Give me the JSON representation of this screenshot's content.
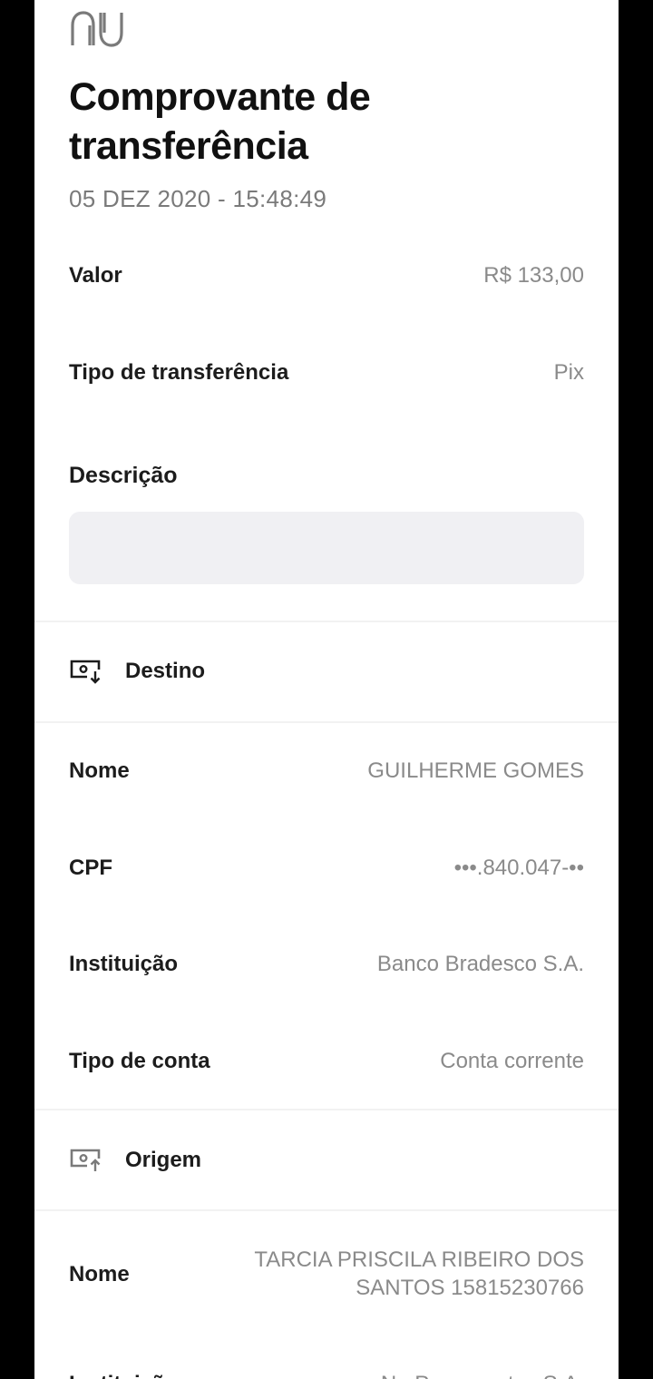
{
  "header": {
    "logo": "nu-logo",
    "title_line1": "Comprovante de",
    "title_line2": "transferência",
    "datetime": "05 DEZ 2020 - 15:48:49"
  },
  "summary": {
    "valor_label": "Valor",
    "valor_value": "R$ 133,00",
    "tipo_label": "Tipo de transferência",
    "tipo_value": "Pix",
    "descricao_label": "Descrição",
    "descricao_value": ""
  },
  "destino": {
    "icon": "screen-download-icon",
    "title": "Destino",
    "nome_label": "Nome",
    "nome_value": "GUILHERME GOMES",
    "cpf_label": "CPF",
    "cpf_value": "•••.840.047-••",
    "instituicao_label": "Instituição",
    "instituicao_value": "Banco Bradesco S.A.",
    "tipo_conta_label": "Tipo de conta",
    "tipo_conta_value": "Conta corrente"
  },
  "origem": {
    "icon": "screen-upload-icon",
    "title": "Origem",
    "nome_label": "Nome",
    "nome_value_line1": "TARCIA PRISCILA RIBEIRO DOS",
    "nome_value_line2": "SANTOS 15815230766",
    "instituicao_label": "Instituição",
    "instituicao_value": "Nu Pagamentos S.A."
  },
  "colors": {
    "background": "#ffffff",
    "frame": "#000000",
    "label": "#1c1c1c",
    "value": "#8a8a8a",
    "box": "#f0f0f3"
  }
}
